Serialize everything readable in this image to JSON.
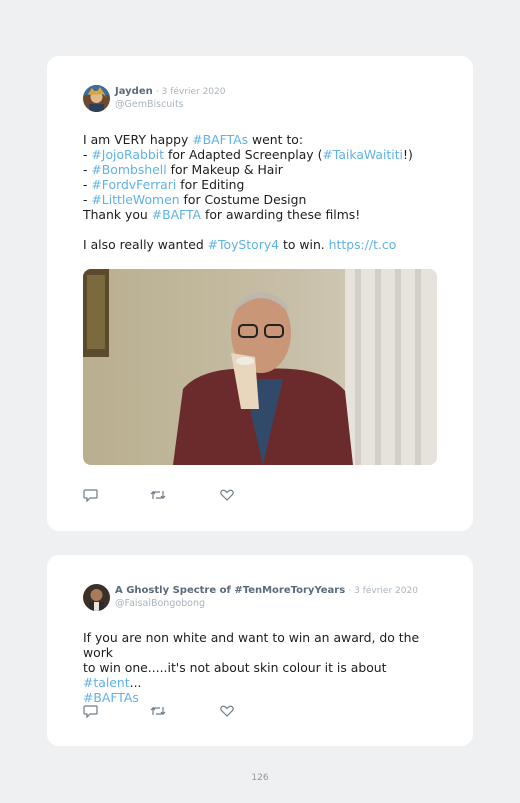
{
  "tweets": [
    {
      "author": "Jayden",
      "date": "· 3 février 2020",
      "handle": "@GemBiscuits",
      "lines": [
        [
          {
            "t": "I am VERY happy "
          },
          {
            "t": "#BAFTAs",
            "tag": true
          },
          {
            "t": " went to:"
          }
        ],
        [
          {
            "t": "- "
          },
          {
            "t": "#JojoRabbit",
            "tag": true
          },
          {
            "t": " for Adapted Screenplay ("
          },
          {
            "t": "#TaikaWaititi",
            "tag": true
          },
          {
            "t": "!)"
          }
        ],
        [
          {
            "t": "- "
          },
          {
            "t": "#Bombshell",
            "tag": true
          },
          {
            "t": " for Makeup & Hair"
          }
        ],
        [
          {
            "t": "- "
          },
          {
            "t": "#FordvFerrari",
            "tag": true
          },
          {
            "t": " for Editing"
          }
        ],
        [
          {
            "t": "- "
          },
          {
            "t": "#LittleWomen",
            "tag": true
          },
          {
            "t": " for Costume Design"
          }
        ],
        [
          {
            "t": "Thank you "
          },
          {
            "t": "#BAFTA",
            "tag": true
          },
          {
            "t": " for awarding these films!"
          }
        ],
        [],
        [
          {
            "t": "I also really wanted "
          },
          {
            "t": "#ToyStory4",
            "tag": true
          },
          {
            "t": " to win. "
          },
          {
            "t": "https://t.co",
            "tag": true
          }
        ]
      ]
    },
    {
      "author": "A Ghostly Spectre of #TenMoreToryYears",
      "date": "· 3 février 2020",
      "handle": "@FaisalBongobong",
      "lines": [
        [
          {
            "t": "If you are non white and want to win an award, do the work"
          }
        ],
        [
          {
            "t": "to win one.....it's not about skin colour it is about "
          },
          {
            "t": "#talent",
            "tag": true
          },
          {
            "t": "..."
          }
        ],
        [
          {
            "t": "#BAFTAs",
            "tag": true
          }
        ]
      ]
    }
  ],
  "icons": {
    "reply": "reply-icon",
    "retweet": "retweet-icon",
    "like": "heart-icon"
  },
  "colors": {
    "hashtag": "#5fb2e6",
    "background": "#eef0f2",
    "card": "#ffffff"
  },
  "page_number": "126"
}
